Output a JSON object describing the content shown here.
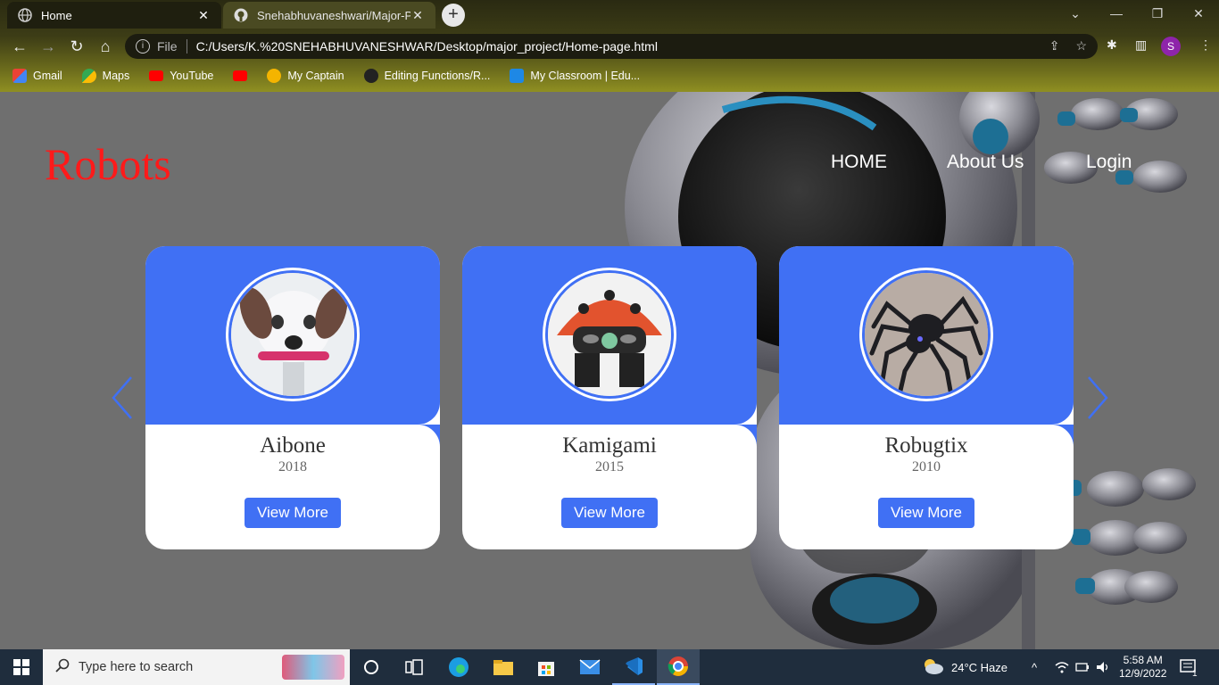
{
  "browser": {
    "tabs": [
      {
        "title": "Home",
        "active": true,
        "icon": "globe-icon"
      },
      {
        "title": "Snehabhuvaneshwari/Major-Proj",
        "active": false,
        "icon": "github-icon"
      }
    ],
    "address": {
      "scheme_label": "File",
      "url": "C:/Users/K.%20SNEHABHUVANESHWAR/Desktop/major_project/Home-page.html"
    },
    "profile_initial": "S",
    "bookmarks": [
      {
        "label": "Gmail",
        "icon": "gmail-icon",
        "color": "#ea4335"
      },
      {
        "label": "Maps",
        "icon": "maps-icon",
        "color": "#34a853"
      },
      {
        "label": "YouTube",
        "icon": "youtube-icon",
        "color": "#ff0000"
      },
      {
        "label": "",
        "icon": "youtube-icon",
        "color": "#ff0000"
      },
      {
        "label": "My Captain",
        "icon": "mycaptain-icon",
        "color": "#f4b400"
      },
      {
        "label": "Editing Functions/R...",
        "icon": "github-icon",
        "color": "#333333"
      },
      {
        "label": "My Classroom | Edu...",
        "icon": "edu-icon",
        "color": "#1e88e5"
      }
    ]
  },
  "site": {
    "brand": "Robots",
    "brand_color": "#ff1a1a",
    "accent": "#4070f4",
    "nav": [
      "HOME",
      "About Us",
      "Login"
    ],
    "cards": [
      {
        "name": "Aibone",
        "year": "2018",
        "button": "View More",
        "image": "robot-dog-image"
      },
      {
        "name": "Kamigami",
        "year": "2015",
        "button": "View More",
        "image": "ladybug-robot-image"
      },
      {
        "name": "Robugtix",
        "year": "2010",
        "button": "View More",
        "image": "spider-robot-image"
      }
    ]
  },
  "taskbar": {
    "search_placeholder": "Type here to search",
    "weather": "24°C  Haze",
    "time": "5:58 AM",
    "date": "12/9/2022",
    "notification_count": "1"
  }
}
